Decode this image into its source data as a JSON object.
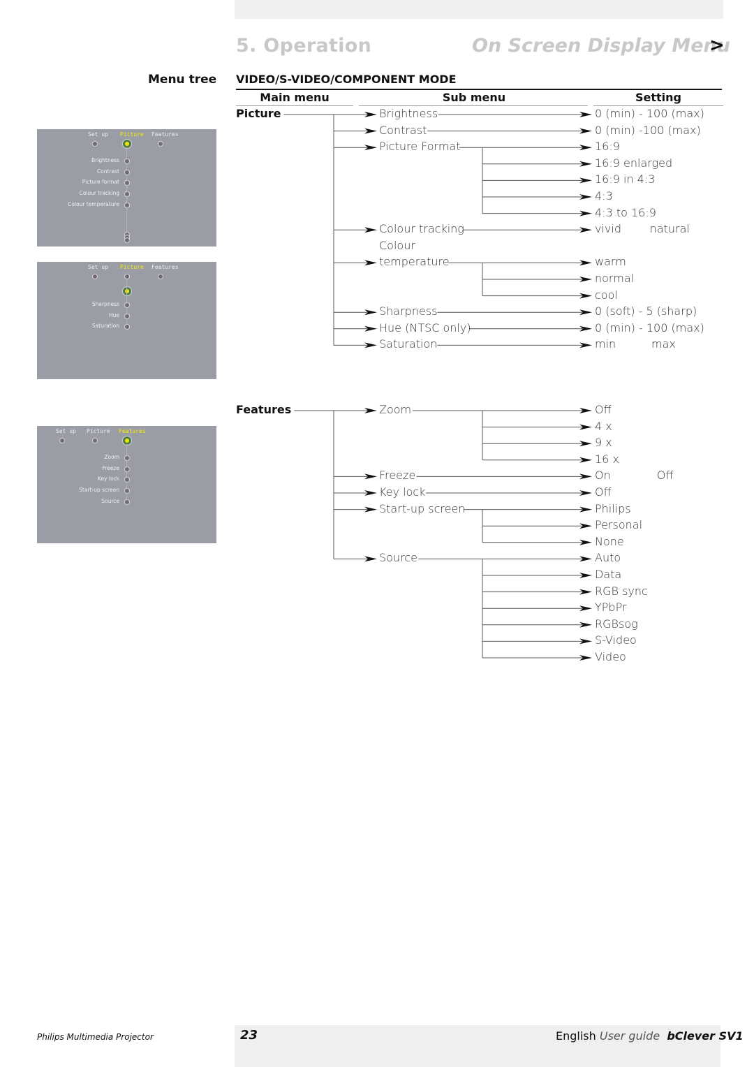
{
  "header": {
    "section": "5. Operation",
    "title": "On Screen Display Menu",
    "next_glyph": ">"
  },
  "labels": {
    "menu_tree": "Menu tree",
    "mode": "VIDEO/S-VIDEO/COMPONENT MODE"
  },
  "columns": {
    "main": "Main menu",
    "sub": "Sub menu",
    "setting": "Setting"
  },
  "tree": [
    {
      "main": "Picture",
      "submenus": [
        {
          "label": "Brightness",
          "settings": [
            "0 (min) - 100 (max)"
          ]
        },
        {
          "label": "Contrast",
          "settings": [
            "0 (min) -100 (max)"
          ]
        },
        {
          "label": "Picture Format",
          "settings": [
            "16:9",
            "16:9 enlarged",
            "16:9 in 4:3",
            "4:3",
            "4:3 to 16:9"
          ]
        },
        {
          "label": "Colour tracking",
          "settings": [
            "vivid        natural"
          ]
        },
        {
          "label_line1": "Colour",
          "label": "temperature",
          "settings": [
            "warm",
            "normal",
            "cool"
          ]
        },
        {
          "label": "Sharpness",
          "settings": [
            "0 (soft) - 5 (sharp)"
          ]
        },
        {
          "label": "Hue (NTSC only)",
          "settings": [
            "0 (min) - 100 (max)"
          ]
        },
        {
          "label": "Saturation",
          "settings": [
            "min          max"
          ]
        }
      ]
    },
    {
      "main": "Features",
      "submenus": [
        {
          "label": "Zoom",
          "settings": [
            "Off",
            "4 x",
            "9 x",
            "16 x"
          ]
        },
        {
          "label": "Freeze",
          "settings": [
            "On             Off"
          ]
        },
        {
          "label": "Key lock",
          "settings": [
            "Off"
          ]
        },
        {
          "label": "Start-up screen",
          "settings": [
            "Philips",
            "Personal",
            "None"
          ]
        },
        {
          "label": "Source",
          "settings": [
            "Auto",
            "Data",
            "RGB sync",
            "YPbPr",
            "RGBsog",
            "S-Video",
            "Video"
          ]
        }
      ]
    }
  ],
  "osd_panels": [
    {
      "tabs": [
        "Set up",
        "Picture",
        "Features"
      ],
      "active_tab": 1,
      "items": [
        "Brightness",
        "Contrast",
        "Picture format",
        "Colour tracking",
        "Colour temperature"
      ],
      "more_indicator": true
    },
    {
      "tabs": [
        "Set up",
        "Picture",
        "Features"
      ],
      "active_tab": 1,
      "items": [
        "Sharpness",
        "Hue",
        "Saturation"
      ],
      "more_indicator": false
    },
    {
      "tabs": [
        "Set up",
        "Picture",
        "Features"
      ],
      "active_tab": 2,
      "items": [
        "Zoom",
        "Freeze",
        "Key lock",
        "Start-up screen",
        "Source"
      ],
      "more_indicator": false
    }
  ],
  "footer": {
    "product": "Philips Multimedia Projector",
    "page": "23",
    "language": "English",
    "guide": "User guide",
    "model": "bClever SV1"
  },
  "colors": {
    "header_gray": "#c8c8c8",
    "band_gray": "#efefef",
    "panel_bg": "#9a9ca6",
    "active_yellow": "#f5f000"
  }
}
